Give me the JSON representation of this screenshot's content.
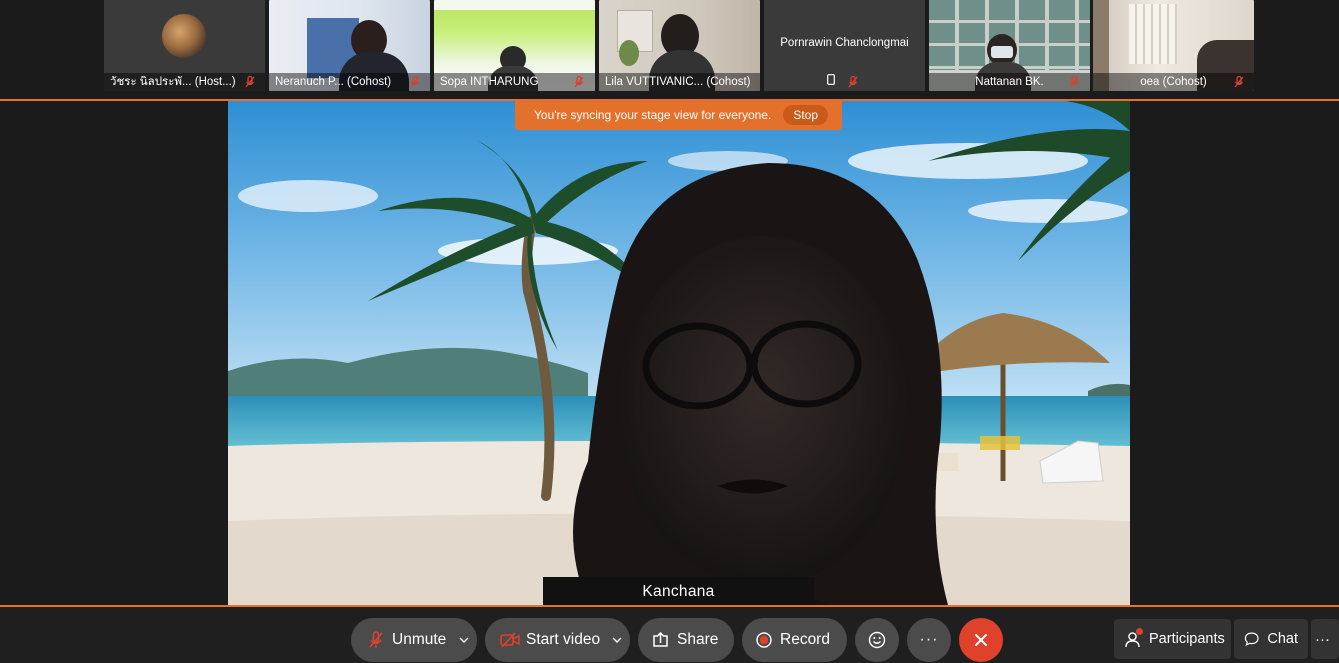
{
  "participants": [
    {
      "label": "วัชระ นิลประพั...  (Host...)"
    },
    {
      "label": "Neranuch P...   (Cohost)"
    },
    {
      "label": "Sopa INTHARUNG"
    },
    {
      "label": "Lila VUTTIVANIC...   (Cohost)"
    },
    {
      "name": "Pornrawin Chanclongmai"
    },
    {
      "label": "Nattanan BK."
    },
    {
      "label": "oea  (Cohost)"
    }
  ],
  "banner": {
    "message": "You're syncing your stage view for everyone.",
    "stop_label": "Stop"
  },
  "stage": {
    "speaker_name": "Kanchana"
  },
  "toolbar": {
    "unmute": "Unmute",
    "start_video": "Start video",
    "share": "Share",
    "record": "Record",
    "more": "···",
    "participants": "Participants",
    "chat": "Chat",
    "overflow": "···"
  },
  "colors": {
    "accent": "#e5712b",
    "hangup": "#e0412b",
    "mic_muted": "#d9412c"
  }
}
